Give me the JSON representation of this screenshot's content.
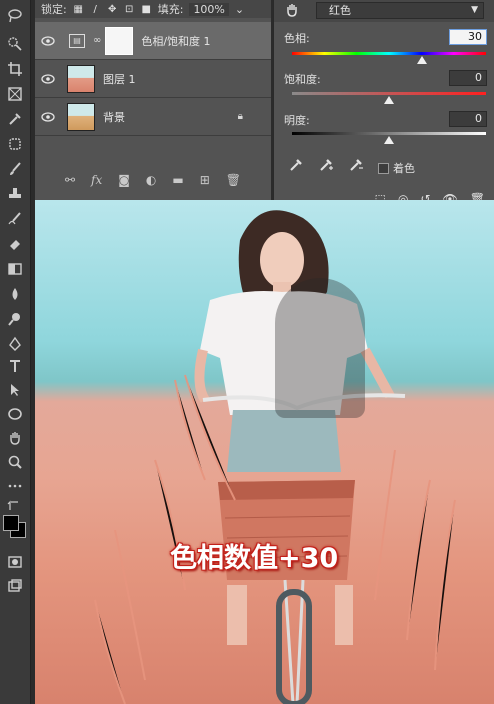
{
  "layers_panel": {
    "lock_label": "锁定:",
    "fill_label": "填充:",
    "fill_value": "100%",
    "layers": [
      {
        "name": "色相/饱和度 1",
        "selected": true
      },
      {
        "name": "图层 1",
        "selected": false
      },
      {
        "name": "背景",
        "selected": false
      }
    ],
    "footer_icons": [
      "link-icon",
      "fx-icon",
      "mask-icon",
      "adjustment-icon",
      "folder-icon",
      "new-layer-icon",
      "trash-icon"
    ]
  },
  "properties": {
    "channel_dropdown": "红色",
    "hue_label": "色相:",
    "hue_value": "30",
    "saturation_label": "饱和度:",
    "saturation_value": "0",
    "lightness_label": "明度:",
    "lightness_value": "0",
    "colorize_label": "着色",
    "hue_slider_level": 0.67,
    "saturation_slider_level": 0.5,
    "lightness_slider_level": 0.5
  },
  "canvas": {
    "caption": "色相数值+30"
  },
  "colors": {
    "panel": "#535353",
    "caption_stroke": "#c3221b"
  }
}
